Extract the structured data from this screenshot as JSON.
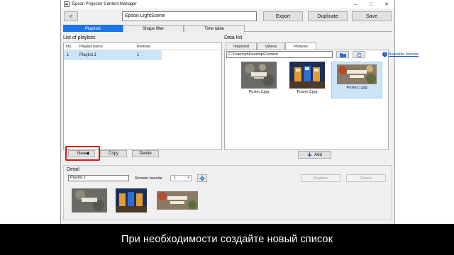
{
  "window": {
    "title": "Epson Projector Content Manager"
  },
  "toolbar": {
    "back_label": "<",
    "name_value": "Epson LightScene",
    "export_label": "Export",
    "duplicate_label": "Duplicate",
    "save_label": "Save"
  },
  "tabs": [
    {
      "label": "Playlists",
      "active": true
    },
    {
      "label": "Shape filter",
      "active": false
    },
    {
      "label": "Time table",
      "active": false
    }
  ],
  "playlists": {
    "title": "List of playlists",
    "columns": [
      "No.",
      "Playlist name",
      "Remote"
    ],
    "rows": [
      {
        "no": "1",
        "name": "Playlist.1",
        "remote": "1"
      }
    ],
    "new_label": "New",
    "copy_label": "Copy",
    "delete_label": "Delete"
  },
  "data_list": {
    "title": "Data list",
    "tabs": [
      {
        "label": "Imported"
      },
      {
        "label": "Videos"
      },
      {
        "label": "Pictures",
        "active": true
      }
    ],
    "path": "C:\\Users\\jd\\Desktop\\Content",
    "help_label": "Available formats",
    "items": [
      {
        "name": "Poster.2.jpg",
        "selected": false
      },
      {
        "name": "Poster.3.jpg",
        "selected": false
      },
      {
        "name": "Poster.1.jpg",
        "selected": true
      }
    ],
    "add_label": "Add"
  },
  "detail": {
    "title": "Detail",
    "playlist_name": "Playlist.1",
    "remote_favorite_label": "Remote favorite",
    "remote_favorite_value": "1",
    "register_label": "Register",
    "cancel_label": "Cancel"
  },
  "caption": "При необходимости создайте новый список",
  "colors": {
    "accent": "#1e73e8",
    "highlight": "#e2141a",
    "selection": "#cde4f8"
  },
  "icons": [
    "folder-icon",
    "refresh-icon",
    "help-icon",
    "arrow-down-icon",
    "gear-icon",
    "back-arrow-icon"
  ]
}
